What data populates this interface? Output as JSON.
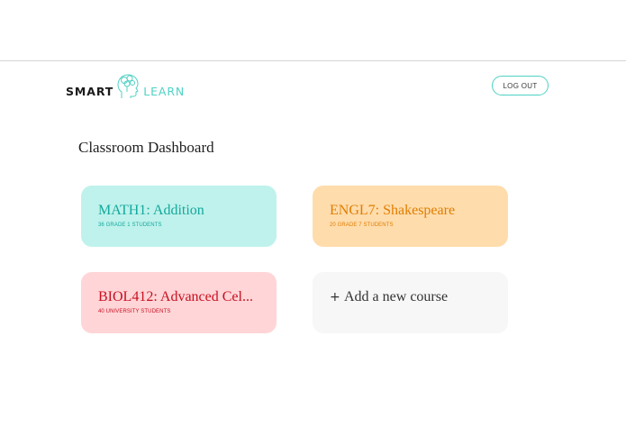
{
  "header": {
    "logo": {
      "word_left": "SMART",
      "word_right": "LEARN",
      "icon": "head-with-bubbles-icon"
    },
    "logout_label": "LOG OUT"
  },
  "page": {
    "title": "Classroom Dashboard"
  },
  "courses": [
    {
      "title": "MATH1: Addition",
      "subtitle": "36 GRADE 1 STUDENTS",
      "color": "#bff2ec",
      "text_color": "#14a89c"
    },
    {
      "title": "ENGL7: Shakespeare",
      "subtitle": "20 GRADE 7 STUDENTS",
      "color": "#ffdcac",
      "text_color": "#e07e00"
    },
    {
      "title": "BIOL412: Advanced Cel...",
      "subtitle": "40 UNIVERSITY STUDENTS",
      "color": "#ffd5d7",
      "text_color": "#c81020"
    }
  ],
  "add_course": {
    "icon": "plus-icon",
    "label": "Add a new course"
  },
  "colors": {
    "accent": "#4fd1c5"
  }
}
